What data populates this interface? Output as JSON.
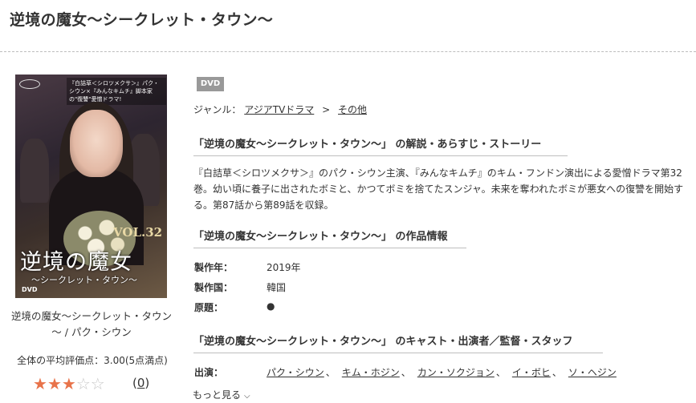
{
  "page": {
    "title": "逆境の魔女～シークレット・タウン～"
  },
  "cover": {
    "tagline": "『白詰草＜シロツメクサ＞』パク・シウン×『みんなキムチ』脚本家の\"復讐\"愛憎ドラマ!",
    "vol": "VOL.32",
    "title": "逆境の魔女",
    "subtitle": "～シークレット・タウン～",
    "dvd_logo": "DVD"
  },
  "product": {
    "caption": "逆境の魔女～シークレット・タウン～ / パク・シウン",
    "avg_rating_text": "全体の平均評価点：3.00(5点満点)",
    "rating": 3,
    "rating_max": 5,
    "review_count": "0"
  },
  "badge": "DVD",
  "genre": {
    "label": "ジャンル：",
    "items": [
      "アジアTVドラマ",
      "その他"
    ],
    "separator": ">"
  },
  "sections": {
    "story_title": "「逆境の魔女～シークレット・タウン～」 の解説・あらすじ・ストーリー",
    "story_text": "『白詰草＜シロツメクサ＞』のパク・シウン主演、『みんなキムチ』のキム・フンドン演出による愛憎ドラマ第32巻。幼い頃に養子に出されたボミと、かつてボミを捨てたスンジャ。未来を奪われたボミが悪女への復讐を開始する。第87話から第89話を収録。",
    "info_title": "「逆境の魔女～シークレット・タウン～」 の作品情報",
    "cast_title": "「逆境の魔女～シークレット・タウン～」 のキャスト・出演者／監督・スタッフ"
  },
  "info": [
    {
      "label": "製作年：",
      "value": "2019年"
    },
    {
      "label": "製作国：",
      "value": "韓国"
    },
    {
      "label": "原題：",
      "value": "●"
    }
  ],
  "cast": {
    "label": "出演：",
    "names": [
      "パク・シウン",
      "キム・ホジン",
      "カン・ソクジョン",
      "イ・ボヒ",
      "ソ・ヘジン"
    ],
    "separator": "、"
  },
  "more_label": "もっと見る"
}
